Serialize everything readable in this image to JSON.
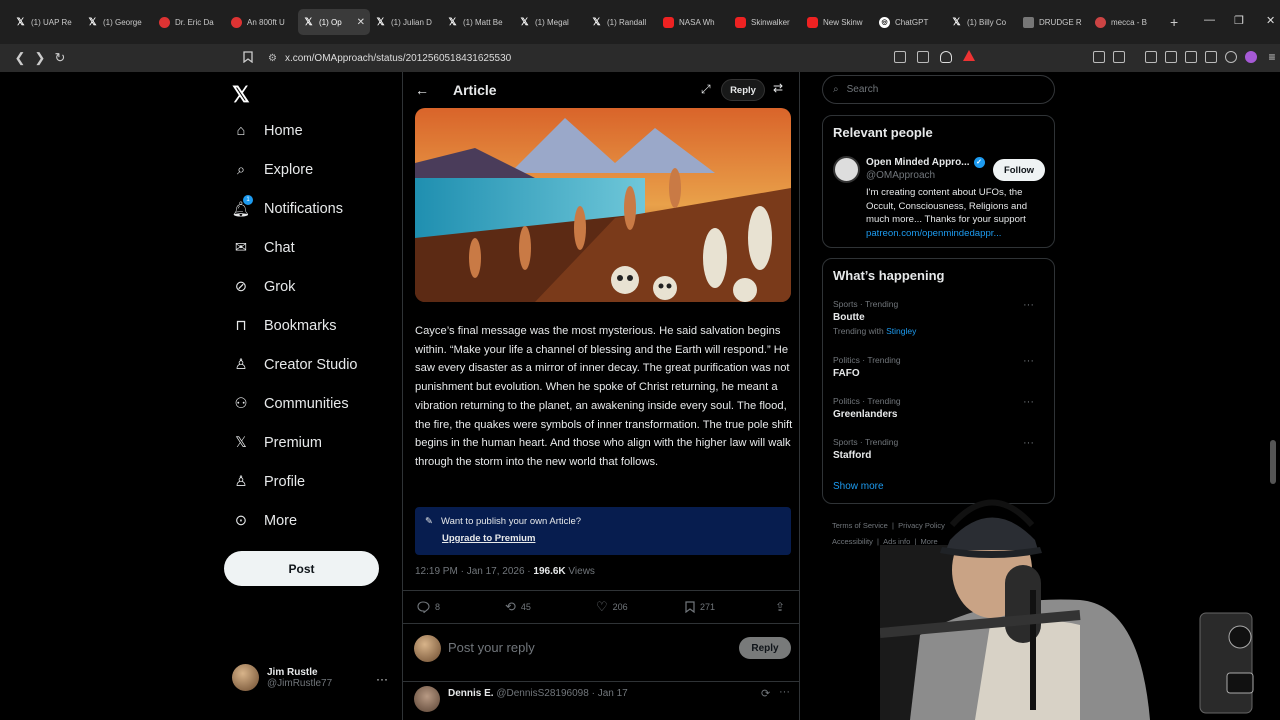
{
  "browser": {
    "tabs": [
      {
        "label": "(1) UAP Re",
        "icon": "x-icon",
        "fav": "x"
      },
      {
        "label": "(1) George",
        "icon": "x-icon",
        "fav": "x"
      },
      {
        "label": "Dr. Eric Da",
        "icon": "reddit-icon",
        "fav": "red"
      },
      {
        "label": "An 800ft U",
        "icon": "reddit-icon",
        "fav": "red"
      },
      {
        "label": "(1) Op",
        "icon": "x-icon",
        "fav": "x",
        "active": true
      },
      {
        "label": "(1) Julian D",
        "icon": "x-icon",
        "fav": "x"
      },
      {
        "label": "(1) Matt Be",
        "icon": "x-icon",
        "fav": "x"
      },
      {
        "label": "(1) Megal",
        "icon": "x-icon",
        "fav": "x"
      },
      {
        "label": "(1) Randall",
        "icon": "x-icon",
        "fav": "x"
      },
      {
        "label": "NASA Wh",
        "icon": "youtube-icon",
        "fav": "yt"
      },
      {
        "label": "Skinwalker",
        "icon": "youtube-icon",
        "fav": "yt"
      },
      {
        "label": "New Skinw",
        "icon": "youtube-icon",
        "fav": "yt"
      },
      {
        "label": "ChatGPT",
        "icon": "chatgpt-icon",
        "fav": "gpt"
      },
      {
        "label": "(1) Billy Co",
        "icon": "x-icon",
        "fav": "x"
      },
      {
        "label": "DRUDGE R",
        "icon": "page-icon",
        "fav": "blank"
      },
      {
        "label": "mecca - B",
        "icon": "overwolf-icon",
        "fav": "ow"
      }
    ],
    "url": "x.com/OMApproach/status/2012560518431625530"
  },
  "sidebar": {
    "items": [
      {
        "label": "Home",
        "icon": "home-icon"
      },
      {
        "label": "Explore",
        "icon": "search-icon"
      },
      {
        "label": "Notifications",
        "icon": "bell-icon",
        "badge": "1"
      },
      {
        "label": "Chat",
        "icon": "mail-icon"
      },
      {
        "label": "Grok",
        "icon": "grok-icon"
      },
      {
        "label": "Bookmarks",
        "icon": "bookmark-icon"
      },
      {
        "label": "Creator Studio",
        "icon": "creator-icon"
      },
      {
        "label": "Communities",
        "icon": "communities-icon"
      },
      {
        "label": "Premium",
        "icon": "x-icon"
      },
      {
        "label": "Profile",
        "icon": "person-icon"
      },
      {
        "label": "More",
        "icon": "more-circle-icon"
      }
    ],
    "post_label": "Post",
    "account": {
      "name": "Jim Rustle",
      "handle": "@JimRustle77"
    }
  },
  "article": {
    "header_title": "Article",
    "reply_label": "Reply",
    "body": "Cayce’s final message was the most mysterious. He said salvation begins  within. “Make your life a channel of blessing and the Earth will respond.” He saw every disaster as a mirror of inner decay. The great purification was not punishment but evolution. When he spoke of Christ returning, he meant a vibration returning to the planet, an awakening inside every soul. The flood, the fire, the quakes were symbols of inner transformation. The true pole shift begins in the human heart. And those who align with the higher law will walk through the storm into the new world that follows.",
    "promo": {
      "text": "Want to publish your own Article?",
      "link": "Upgrade to Premium"
    },
    "meta": {
      "time": "12:19 PM · Jan 17, 2026 · ",
      "views": "196.6K",
      "views_label": " Views"
    },
    "counts": {
      "replies": "8",
      "reposts": "45",
      "likes": "206",
      "bookmarks": "271"
    },
    "reply_placeholder": "Post your reply",
    "reply_button": "Reply",
    "comment": {
      "name": "Dennis E.",
      "handle": "@DennisS28196098 · Jan 17"
    }
  },
  "right": {
    "search_placeholder": "Search",
    "relevant": {
      "title": "Relevant people",
      "name": "Open Minded Appro...",
      "handle": "@OMApproach",
      "follow": "Follow",
      "bio": "I'm creating content about UFOs, the Occult, Consciousness, Religions and much more... Thanks for your support",
      "link": "patreon.com/openmindedappr..."
    },
    "happening": {
      "title": "What’s happening",
      "trends": [
        {
          "category": "Sports · Trending",
          "name": "Boutte",
          "with_label": "Trending with ",
          "with": "Stingley"
        },
        {
          "category": "Politics · Trending",
          "name": "FAFO"
        },
        {
          "category": "Politics · Trending",
          "name": "Greenlanders"
        },
        {
          "category": "Sports · Trending",
          "name": "Stafford"
        }
      ],
      "show_more": "Show more"
    },
    "footer": {
      "l1a": "Terms of Service",
      "l1b": "Privacy Policy",
      "l2a": "Accessibility",
      "l2b": "Ads info",
      "l2c": "More"
    }
  }
}
